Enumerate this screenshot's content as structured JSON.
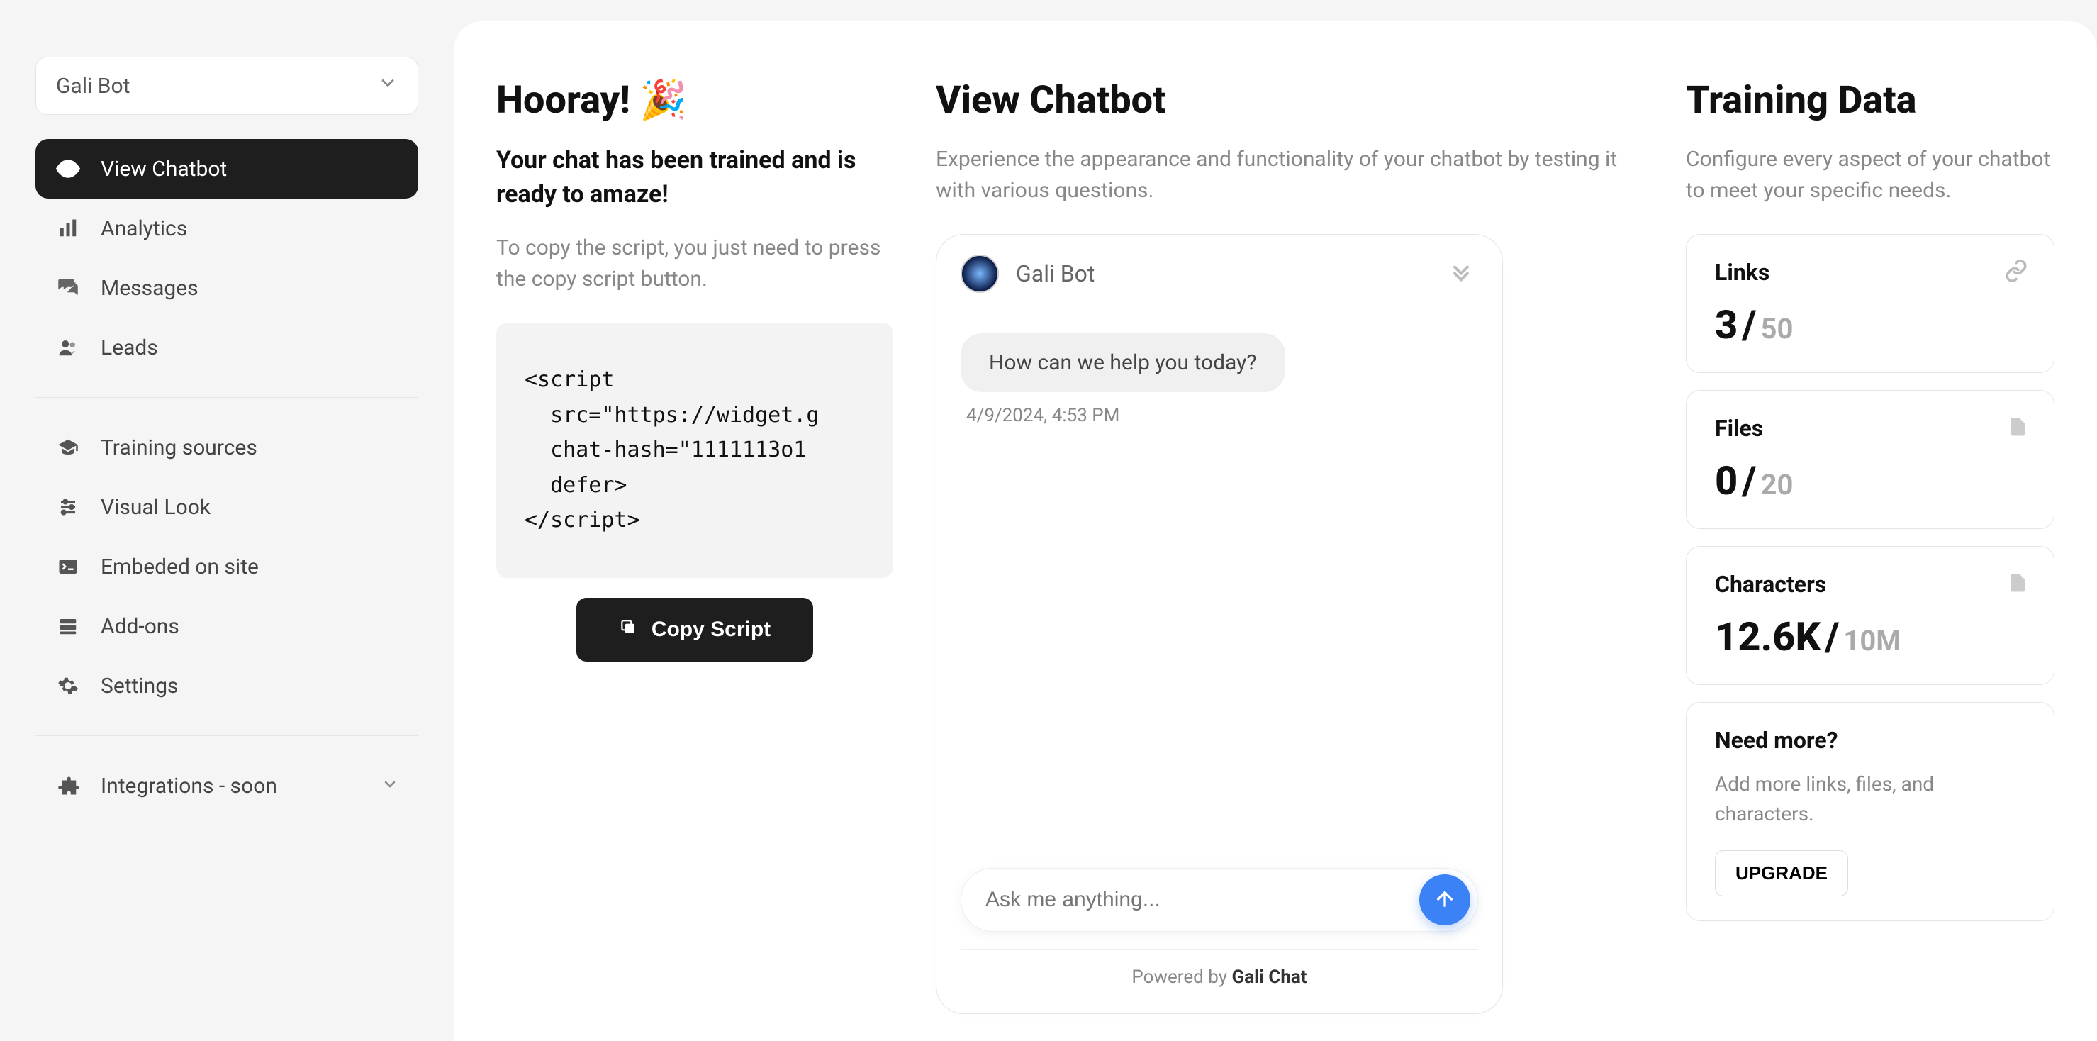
{
  "sidebar": {
    "bot_selector": "Gali Bot",
    "nav": [
      {
        "label": "View Chatbot"
      },
      {
        "label": "Analytics"
      },
      {
        "label": "Messages"
      },
      {
        "label": "Leads"
      }
    ],
    "nav2": [
      {
        "label": "Training sources"
      },
      {
        "label": "Visual Look"
      },
      {
        "label": "Embeded on site"
      },
      {
        "label": "Add-ons"
      },
      {
        "label": "Settings"
      }
    ],
    "nav3": [
      {
        "label": "Integrations - soon"
      }
    ]
  },
  "left": {
    "heading": "Hooray! 🎉",
    "subhead": "Your chat has been trained and is ready to amaze!",
    "note": "To copy the script, you just need to press the copy script button.",
    "code": "<script\n  src=\"https://widget.g\n  chat-hash=\"1111113o1\n  defer>\n</script>",
    "copy_label": "Copy Script"
  },
  "center": {
    "heading": "View Chatbot",
    "desc": "Experience the appearance and functionality of your chatbot by testing it with various questions.",
    "chat": {
      "bot_name": "Gali Bot",
      "welcome": "How can we help you today?",
      "timestamp": "4/9/2024, 4:53 PM",
      "placeholder": "Ask me anything...",
      "powered_prefix": "Powered by ",
      "powered_name": "Gali Chat"
    }
  },
  "right": {
    "heading": "Training Data",
    "desc": "Configure every aspect of your chatbot to meet your specific needs.",
    "cards": {
      "links": {
        "label": "Links",
        "value": "3",
        "limit": "50"
      },
      "files": {
        "label": "Files",
        "value": "0",
        "limit": "20"
      },
      "characters": {
        "label": "Characters",
        "value": "12.6K",
        "limit": "10M"
      }
    },
    "need_more": {
      "title": "Need more?",
      "text": "Add more links, files, and characters.",
      "cta": "UPGRADE"
    }
  }
}
